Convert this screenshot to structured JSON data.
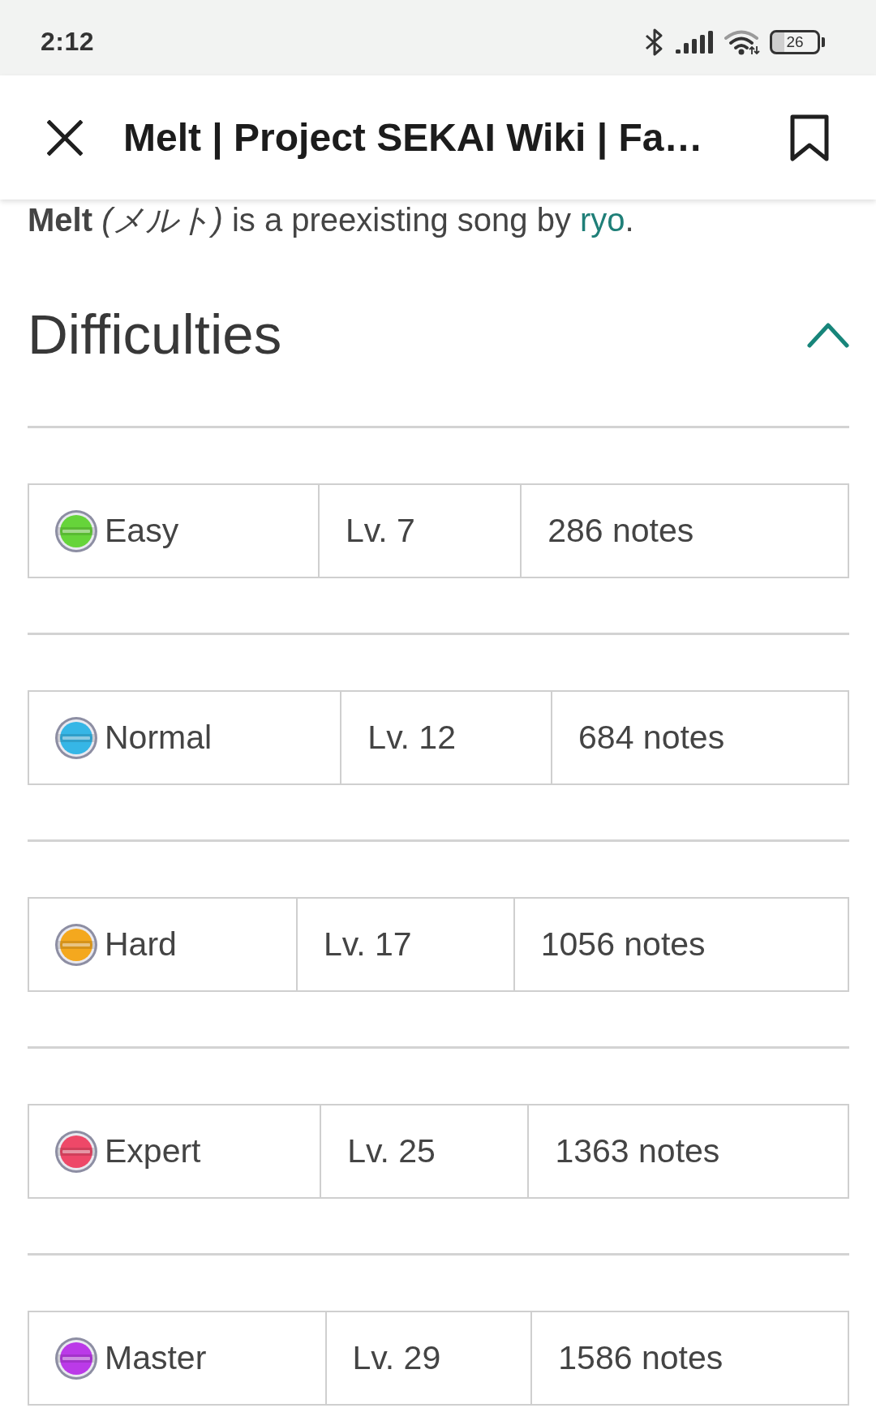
{
  "status_bar": {
    "time": "2:12",
    "battery": "26"
  },
  "header": {
    "title": "Melt | Project SEKAI Wiki | Fa…"
  },
  "intro": {
    "text": "**Melt** *(メルト)* is a preexisting song by ",
    "link": "ryo",
    "end": "."
  },
  "section": {
    "title": "Difficulties",
    "expanded": true
  },
  "difficulties": [
    {
      "name": "Easy",
      "level_label": "Lv. 7",
      "notes": "286 notes",
      "color": "#66d43a"
    },
    {
      "name": "Normal",
      "level_label": "Lv. 12",
      "notes": "684 notes",
      "color": "#36b6e6"
    },
    {
      "name": "Hard",
      "level_label": "Lv. 17",
      "notes": "1056 notes",
      "color": "#f4a81e"
    },
    {
      "name": "Expert",
      "level_label": "Lv. 25",
      "notes": "1363 notes",
      "color": "#ee4868"
    },
    {
      "name": "Master",
      "level_label": "Lv. 29",
      "notes": "1586 notes",
      "color": "#bb3ae8"
    }
  ]
}
